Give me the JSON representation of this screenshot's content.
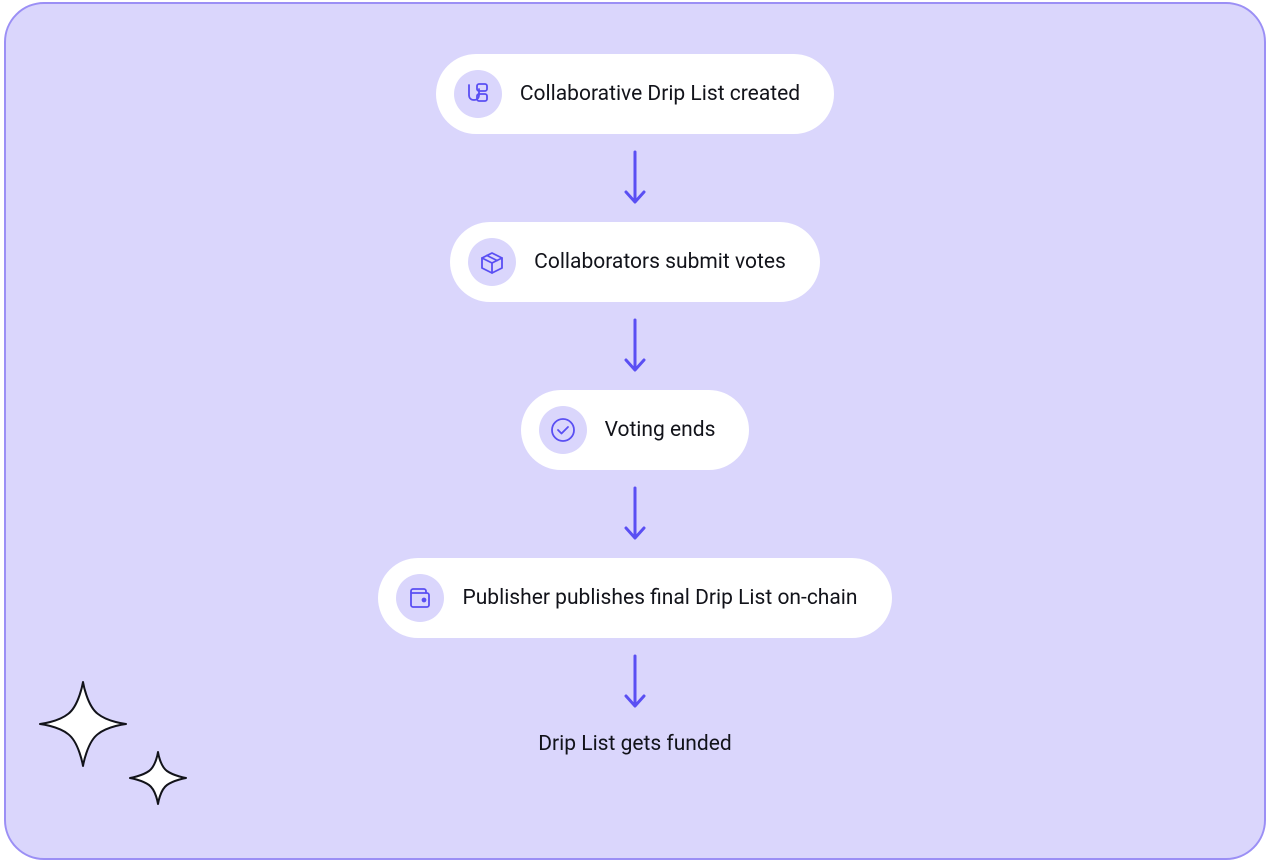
{
  "steps": [
    {
      "icon": "drip-icon",
      "label": "Collaborative Drip List created"
    },
    {
      "icon": "box-icon",
      "label": "Collaborators submit votes"
    },
    {
      "icon": "check-circle-icon",
      "label": "Voting ends"
    },
    {
      "icon": "wallet-icon",
      "label": "Publisher publishes final Drip List on-chain"
    }
  ],
  "final": "Drip List gets funded",
  "colors": {
    "background": "#DAD6FC",
    "border": "#9B8FF5",
    "accent": "#5A4FF3",
    "iconBg": "#DAD6FC",
    "text": "#12131A"
  }
}
